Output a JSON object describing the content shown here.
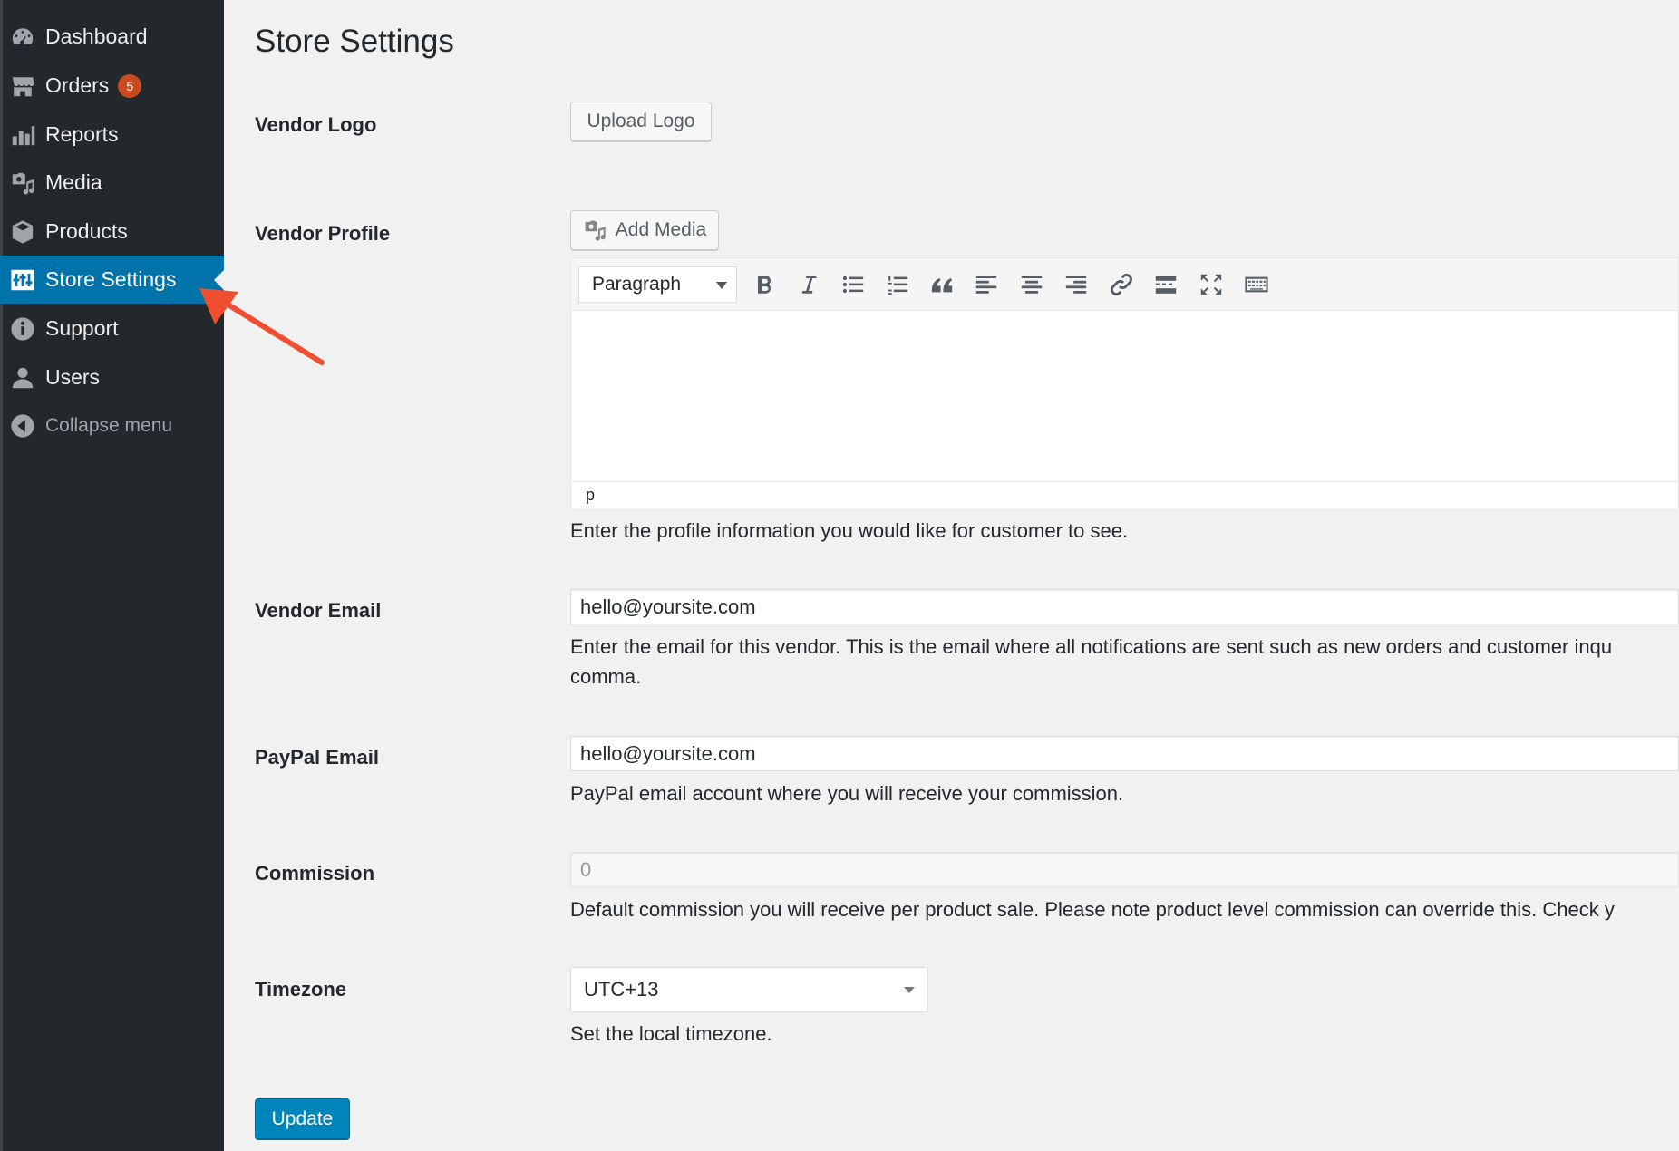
{
  "sidebar": {
    "items": [
      {
        "label": "Dashboard",
        "icon": "dashboard-icon"
      },
      {
        "label": "Orders",
        "icon": "store-icon",
        "badge": "5"
      },
      {
        "label": "Reports",
        "icon": "chart-bar-icon"
      },
      {
        "label": "Media",
        "icon": "media-icon"
      },
      {
        "label": "Products",
        "icon": "box-icon"
      },
      {
        "label": "Store Settings",
        "icon": "settings-sliders-icon",
        "active": true
      },
      {
        "label": "Support",
        "icon": "info-icon"
      },
      {
        "label": "Users",
        "icon": "user-icon"
      }
    ],
    "collapse_label": "Collapse menu"
  },
  "page": {
    "title": "Store Settings"
  },
  "vendor_logo": {
    "label": "Vendor Logo",
    "button": "Upload Logo"
  },
  "vendor_profile": {
    "label": "Vendor Profile",
    "add_media": "Add Media",
    "format": "Paragraph",
    "status_path": "p",
    "description": "Enter the profile information you would like for customer to see."
  },
  "vendor_email": {
    "label": "Vendor Email",
    "value": "hello@yoursite.com",
    "description_line1": "Enter the email for this vendor. This is the email where all notifications are sent such as new orders and customer inqu",
    "description_line2": "comma."
  },
  "paypal_email": {
    "label": "PayPal Email",
    "value": "hello@yoursite.com",
    "description": "PayPal email account where you will receive your commission."
  },
  "commission": {
    "label": "Commission",
    "value": "0",
    "description": "Default commission you will receive per product sale. Please note product level commission can override this. Check y"
  },
  "timezone": {
    "label": "Timezone",
    "value": "UTC+13",
    "description": "Set the local timezone."
  },
  "actions": {
    "update": "Update"
  },
  "colors": {
    "sidebar_bg": "#23282d",
    "active_bg": "#0073aa",
    "badge_bg": "#ca4a1f",
    "primary_button": "#0085ba",
    "annotation_arrow": "#f04e30"
  }
}
